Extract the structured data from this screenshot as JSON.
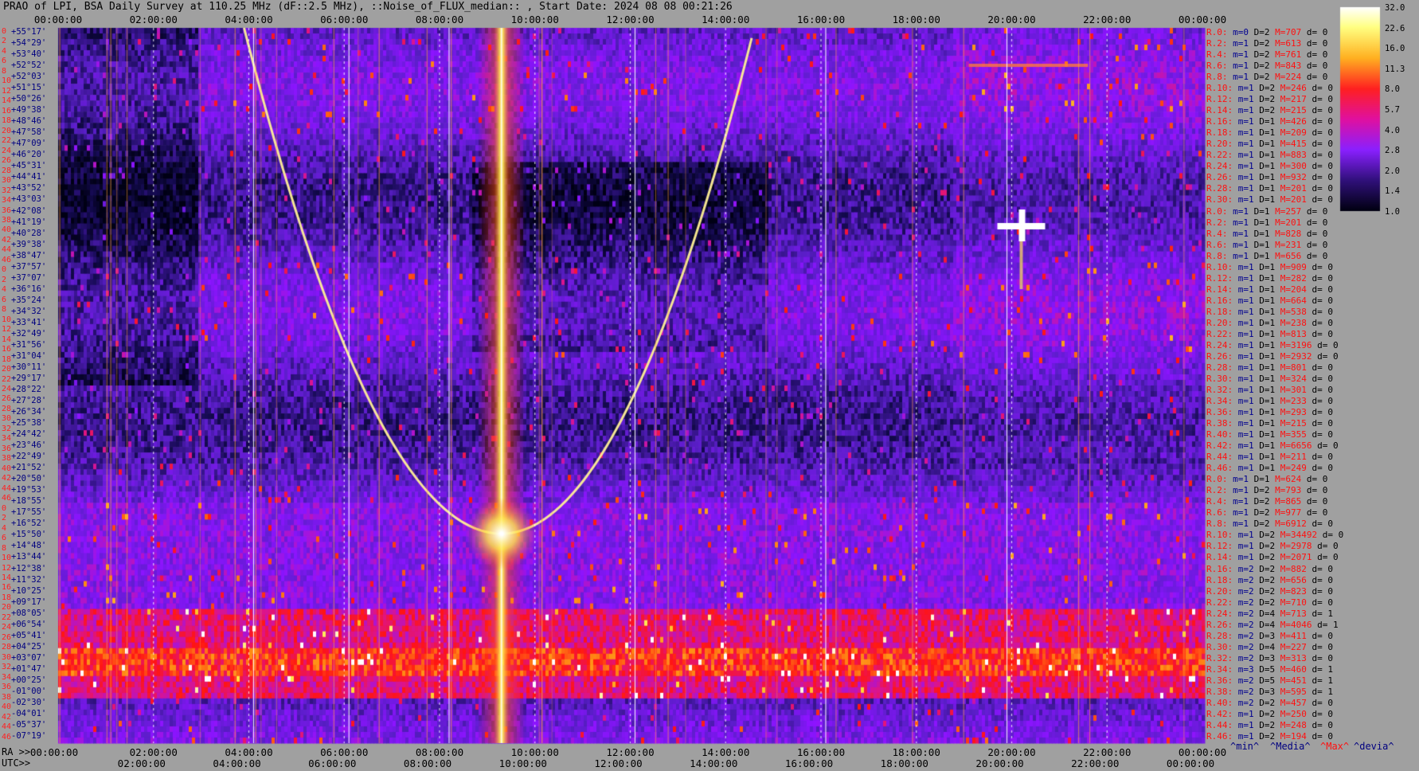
{
  "title": "PRAO of LPI, BSA Daily Survey at 110.25 MHz (dF::2.5 MHz), ::Noise_of_FLUX_median:: , Start Date: 2024 08 08 00:21:26",
  "top_ticks": [
    "00:00:00",
    "02:00:00",
    "04:00:00",
    "06:00:00",
    "08:00:00",
    "10:00:00",
    "12:00:00",
    "14:00:00",
    "16:00:00",
    "18:00:00",
    "20:00:00",
    "22:00:00",
    "00:00:00"
  ],
  "ra_label": "RA >>",
  "ra_ticks": [
    "00:00:00",
    "02:00:00",
    "04:00:00",
    "06:00:00",
    "08:00:00",
    "10:00:00",
    "12:00:00",
    "14:00:00",
    "16:00:00",
    "18:00:00",
    "20:00:00",
    "22:00:00",
    "00:00:00"
  ],
  "utc_label": "UTC>>",
  "utc_ticks": [
    "02:00:00",
    "04:00:00",
    "06:00:00",
    "08:00:00",
    "10:00:00",
    "12:00:00",
    "14:00:00",
    "16:00:00",
    "18:00:00",
    "20:00:00",
    "22:00:00",
    "00:00:00"
  ],
  "declinations": [
    "+55°17'",
    "+54°29'",
    "+53°40'",
    "+52°52'",
    "+52°03'",
    "+51°15'",
    "+50°26'",
    "+49°38'",
    "+48°46'",
    "+47°58'",
    "+47°09'",
    "+46°20'",
    "+45°31'",
    "+44°41'",
    "+43°52'",
    "+43°03'",
    "+42°08'",
    "+41°19'",
    "+40°28'",
    "+39°38'",
    "+38°47'",
    "+37°57'",
    "+37°07'",
    "+36°16'",
    "+35°24'",
    "+34°32'",
    "+33°41'",
    "+32°49'",
    "+31°56'",
    "+31°04'",
    "+30°11'",
    "+29°17'",
    "+28°22'",
    "+27°28'",
    "+26°34'",
    "+25°38'",
    "+24°42'",
    "+23°46'",
    "+22°49'",
    "+21°52'",
    "+20°50'",
    "+19°53'",
    "+18°55'",
    "+17°55'",
    "+16°52'",
    "+15°50'",
    "+14°48'",
    "+13°44'",
    "+12°38'",
    "+11°32'",
    "+10°25'",
    "+09°17'",
    "+08°05'",
    "+06°54'",
    "+05°41'",
    "+04°25'",
    "+03°07'",
    "+01°47'",
    "+00°25'",
    "-01°00'",
    "-02°30'",
    "-04°01'",
    "-05°37'",
    "-07°19'"
  ],
  "beam_index": [
    "0",
    "2",
    "4",
    "6",
    "8",
    "10",
    "12",
    "14",
    "16",
    "18",
    "20",
    "22",
    "24",
    "26",
    "28",
    "30",
    "32",
    "34",
    "36",
    "38",
    "40",
    "42",
    "44",
    "46",
    "0",
    "2",
    "4",
    "6",
    "8",
    "10",
    "12",
    "14",
    "16",
    "18",
    "20",
    "22",
    "24",
    "26",
    "28",
    "30",
    "32",
    "34",
    "36",
    "38",
    "40",
    "42",
    "44",
    "46",
    "0",
    "2",
    "4",
    "6",
    "8",
    "10",
    "12",
    "14",
    "16",
    "18",
    "20",
    "22",
    "24",
    "26",
    "28",
    "30",
    "32",
    "34",
    "36",
    "38",
    "40",
    "42",
    "44",
    "46"
  ],
  "stats_rows": [
    [
      "R.0:",
      "m=0",
      "D=2",
      "M=707",
      "d= 0"
    ],
    [
      "R.2:",
      "m=1",
      "D=2",
      "M=613",
      "d= 0"
    ],
    [
      "R.4:",
      "m=1",
      "D=2",
      "M=761",
      "d= 0"
    ],
    [
      "R.6:",
      "m=1",
      "D=2",
      "M=843",
      "d= 0"
    ],
    [
      "R.8:",
      "m=1",
      "D=2",
      "M=224",
      "d= 0"
    ],
    [
      "R.10:",
      "m=1",
      "D=2",
      "M=246",
      "d= 0"
    ],
    [
      "R.12:",
      "m=1",
      "D=2",
      "M=217",
      "d= 0"
    ],
    [
      "R.14:",
      "m=1",
      "D=2",
      "M=215",
      "d= 0"
    ],
    [
      "R.16:",
      "m=1",
      "D=1",
      "M=426",
      "d= 0"
    ],
    [
      "R.18:",
      "m=1",
      "D=1",
      "M=209",
      "d= 0"
    ],
    [
      "R.20:",
      "m=1",
      "D=1",
      "M=415",
      "d= 0"
    ],
    [
      "R.22:",
      "m=1",
      "D=1",
      "M=883",
      "d= 0"
    ],
    [
      "R.24:",
      "m=1",
      "D=1",
      "M=300",
      "d= 0"
    ],
    [
      "R.26:",
      "m=1",
      "D=1",
      "M=932",
      "d= 0"
    ],
    [
      "R.28:",
      "m=1",
      "D=1",
      "M=201",
      "d= 0"
    ],
    [
      "R.30:",
      "m=1",
      "D=1",
      "M=201",
      "d= 0"
    ],
    [
      "R.0:",
      "m=1",
      "D=1",
      "M=257",
      "d= 0"
    ],
    [
      "R.2:",
      "m=1",
      "D=1",
      "M=201",
      "d= 0"
    ],
    [
      "R.4:",
      "m=1",
      "D=1",
      "M=828",
      "d= 0"
    ],
    [
      "R.6:",
      "m=1",
      "D=1",
      "M=231",
      "d= 0"
    ],
    [
      "R.8:",
      "m=1",
      "D=1",
      "M=656",
      "d= 0"
    ],
    [
      "R.10:",
      "m=1",
      "D=1",
      "M=909",
      "d= 0"
    ],
    [
      "R.12:",
      "m=1",
      "D=1",
      "M=282",
      "d= 0"
    ],
    [
      "R.14:",
      "m=1",
      "D=1",
      "M=204",
      "d= 0"
    ],
    [
      "R.16:",
      "m=1",
      "D=1",
      "M=664",
      "d= 0"
    ],
    [
      "R.18:",
      "m=1",
      "D=1",
      "M=538",
      "d= 0"
    ],
    [
      "R.20:",
      "m=1",
      "D=1",
      "M=238",
      "d= 0"
    ],
    [
      "R.22:",
      "m=1",
      "D=1",
      "M=813",
      "d= 0"
    ],
    [
      "R.24:",
      "m=1",
      "D=1",
      "M=3196",
      "d= 0"
    ],
    [
      "R.26:",
      "m=1",
      "D=1",
      "M=2932",
      "d= 0"
    ],
    [
      "R.28:",
      "m=1",
      "D=1",
      "M=801",
      "d= 0"
    ],
    [
      "R.30:",
      "m=1",
      "D=1",
      "M=324",
      "d= 0"
    ],
    [
      "R.32:",
      "m=1",
      "D=1",
      "M=301",
      "d= 0"
    ],
    [
      "R.34:",
      "m=1",
      "D=1",
      "M=233",
      "d= 0"
    ],
    [
      "R.36:",
      "m=1",
      "D=1",
      "M=293",
      "d= 0"
    ],
    [
      "R.38:",
      "m=1",
      "D=1",
      "M=215",
      "d= 0"
    ],
    [
      "R.40:",
      "m=1",
      "D=1",
      "M=355",
      "d= 0"
    ],
    [
      "R.42:",
      "m=1",
      "D=1",
      "M=6656",
      "d= 0"
    ],
    [
      "R.44:",
      "m=1",
      "D=1",
      "M=211",
      "d= 0"
    ],
    [
      "R.46:",
      "m=1",
      "D=1",
      "M=249",
      "d= 0"
    ],
    [
      "R.0:",
      "m=1",
      "D=1",
      "M=624",
      "d= 0"
    ],
    [
      "R.2:",
      "m=1",
      "D=2",
      "M=793",
      "d= 0"
    ],
    [
      "R.4:",
      "m=1",
      "D=2",
      "M=865",
      "d= 0"
    ],
    [
      "R.6:",
      "m=1",
      "D=2",
      "M=977",
      "d= 0"
    ],
    [
      "R.8:",
      "m=1",
      "D=2",
      "M=6912",
      "d= 0"
    ],
    [
      "R.10:",
      "m=1",
      "D=2",
      "M=34492",
      "d= 0"
    ],
    [
      "R.12:",
      "m=1",
      "D=2",
      "M=2978",
      "d= 0"
    ],
    [
      "R.14:",
      "m=1",
      "D=2",
      "M=2071",
      "d= 0"
    ],
    [
      "R.16:",
      "m=2",
      "D=2",
      "M=882",
      "d= 0"
    ],
    [
      "R.18:",
      "m=2",
      "D=2",
      "M=656",
      "d= 0"
    ],
    [
      "R.20:",
      "m=2",
      "D=2",
      "M=823",
      "d= 0"
    ],
    [
      "R.22:",
      "m=2",
      "D=2",
      "M=710",
      "d= 0"
    ],
    [
      "R.24:",
      "m=2",
      "D=4",
      "M=713",
      "d= 1"
    ],
    [
      "R.26:",
      "m=2",
      "D=4",
      "M=4046",
      "d= 1"
    ],
    [
      "R.28:",
      "m=2",
      "D=3",
      "M=411",
      "d= 0"
    ],
    [
      "R.30:",
      "m=2",
      "D=4",
      "M=227",
      "d= 0"
    ],
    [
      "R.32:",
      "m=2",
      "D=3",
      "M=313",
      "d= 0"
    ],
    [
      "R.34:",
      "m=3",
      "D=5",
      "M=460",
      "d= 1"
    ],
    [
      "R.36:",
      "m=2",
      "D=5",
      "M=451",
      "d= 1"
    ],
    [
      "R.38:",
      "m=2",
      "D=3",
      "M=595",
      "d= 1"
    ],
    [
      "R.40:",
      "m=2",
      "D=2",
      "M=457",
      "d= 0"
    ],
    [
      "R.42:",
      "m=1",
      "D=2",
      "M=250",
      "d= 0"
    ],
    [
      "R.44:",
      "m=1",
      "D=2",
      "M=248",
      "d= 0"
    ],
    [
      "R.46:",
      "m=1",
      "D=2",
      "M=194",
      "d= 0"
    ]
  ],
  "colorbar_ticks": [
    "32.0",
    "22.6",
    "16.0",
    "11.3",
    "8.0",
    "5.7",
    "4.0",
    "2.8",
    "2.0",
    "1.4",
    "1.0"
  ],
  "footer_labels": [
    "^min^",
    "^Media^",
    "^Max^",
    "^devia^"
  ],
  "colors": {
    "background": "#a0a0a0",
    "low": "#000010",
    "mid": "#7a1cff",
    "high": "#ff1010",
    "peak": "#ffffff"
  },
  "chart_data": {
    "type": "heatmap",
    "title": "PRAO of LPI, BSA Daily Survey at 110.25 MHz (dF::2.5 MHz), ::Noise_of_FLUX_median:: , Start Date: 2024 08 08 00:21:26",
    "x_axis": "RA 00:00:00 – 24:00:00",
    "y_axis": "Declination +55°17' to -07°19'",
    "colorscale": [
      1.0,
      1.4,
      2.0,
      2.8,
      4.0,
      5.7,
      8.0,
      11.3,
      16.0,
      22.6,
      32.0
    ],
    "features": [
      {
        "kind": "vertical bright band",
        "ra_hours": 9.3,
        "intensity": 32
      },
      {
        "kind": "parabolic track",
        "vertex_ra_hours": 9.3,
        "left_ra_top_hours": 3.9,
        "right_ra_top_hours": 14.6
      },
      {
        "kind": "bright spot",
        "ra_hours": 20.2,
        "intensity": 32
      },
      {
        "kind": "horizontal band",
        "dec_range": [
          "+08°05'",
          "-01°00'"
        ],
        "intensity": 6
      }
    ]
  }
}
